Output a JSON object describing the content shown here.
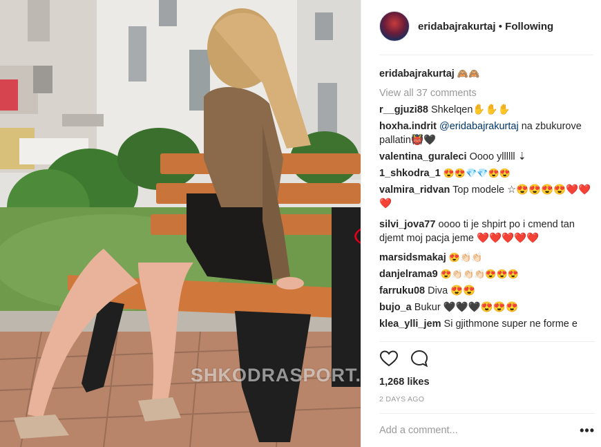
{
  "photo": {
    "watermark": "SHKODRASPORT.COM"
  },
  "header": {
    "username": "eridabajrakurtaj",
    "separator": "•",
    "follow_status": "Following"
  },
  "caption": {
    "username": "eridabajrakurtaj",
    "text": "🙈🙈"
  },
  "view_all_comments": "View all 37 comments",
  "comments": [
    {
      "user": "r__gjuzi88",
      "text": "Shkelqen✋✋✋"
    },
    {
      "user": "hoxha.indrit",
      "mention": "@eridabajrakurtaj",
      "text": " na zbukurove pallatin👹🖤"
    },
    {
      "user": "valentina_guraleci",
      "text": "Oooo yllllll ⇣"
    },
    {
      "user": "1_shkodra_1",
      "text": "😍😍💎💎😍😍"
    },
    {
      "user": "valmira_ridvan",
      "text": "Top modele ☆😍😍😍😍❤️❤️❤️"
    },
    {
      "user": "silvi_jova77",
      "text": "oooo ti je shpirt po i cmend tan djemt moj pacja jeme ❤️❤️❤️❤️❤️"
    },
    {
      "user": "marsidsmakaj",
      "text": "😍👏🏻👏🏻"
    },
    {
      "user": "danjelrama9",
      "text": "😍👏🏻👏🏻👏🏻😍😍😍"
    },
    {
      "user": "farruku08",
      "text": "Diva 😍😍"
    },
    {
      "user": "bujo_a",
      "text": "Bukur 🖤🖤🖤😍😍😍"
    },
    {
      "user": "klea_ylli_jem",
      "text": "Si gjithmone super ne forme e"
    }
  ],
  "actions": {
    "like_icon": "heart-outline-icon",
    "comment_icon": "speech-bubble-icon",
    "likes_count": "1,268 likes",
    "timestamp": "2 DAYS AGO"
  },
  "add_comment": {
    "placeholder": "Add a comment...",
    "more_label": "•••"
  },
  "colors": {
    "highlight_ring": "#e0001b",
    "muted_text": "#999999",
    "mention": "#003569"
  }
}
